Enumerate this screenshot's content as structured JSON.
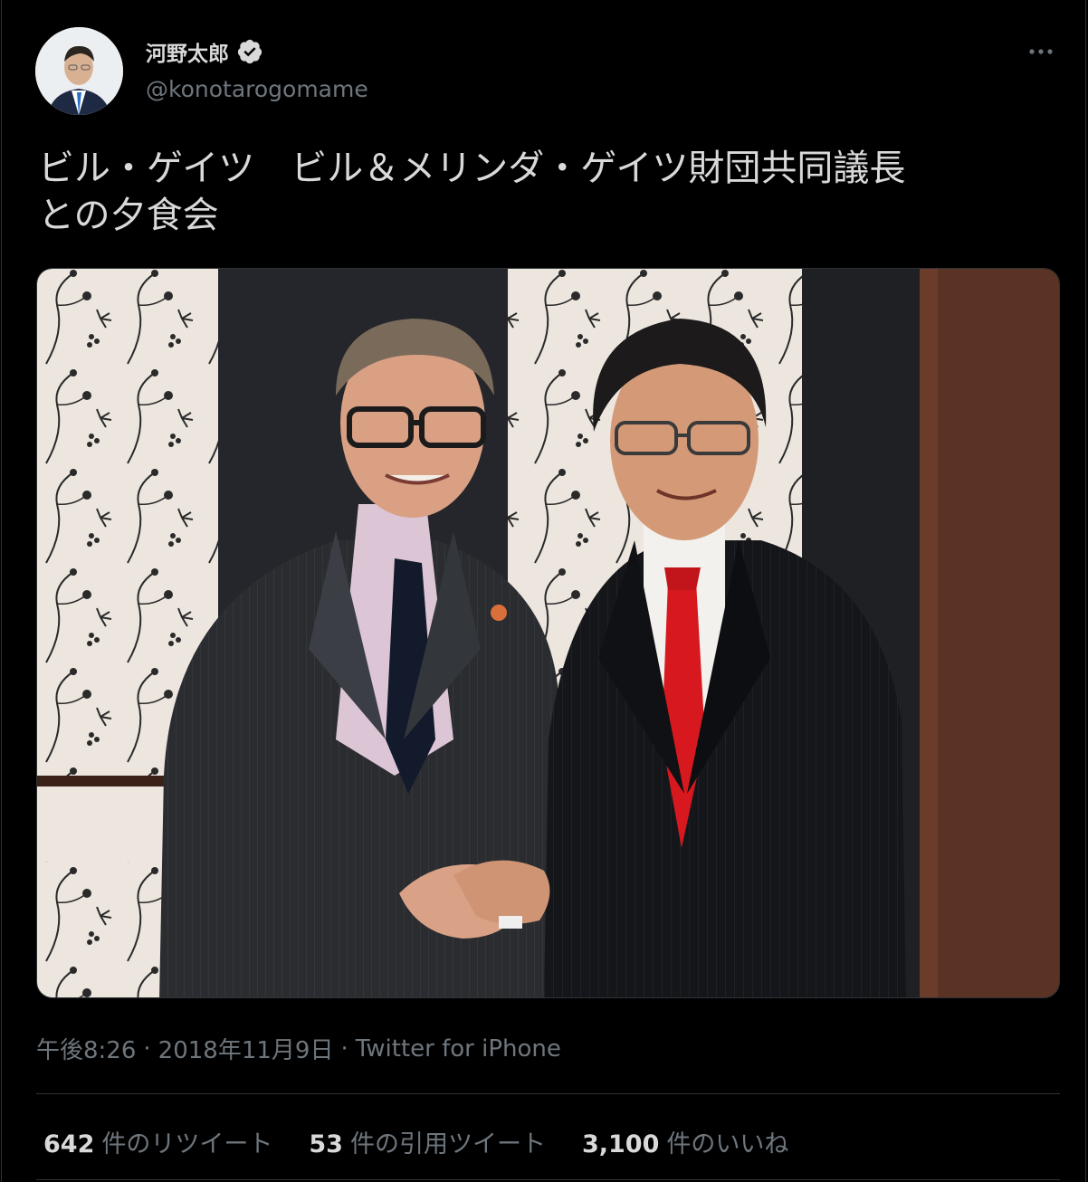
{
  "author": {
    "name": "河野太郎",
    "handle": "@konotarogomame",
    "verified_icon": "verified-badge-icon"
  },
  "more_icon": "more-horizontal-icon",
  "tweet": {
    "text": "ビル・ゲイツ　ビル＆メリンダ・ゲイツ財団共同議長\nとの夕食会"
  },
  "meta": {
    "time": "午後8:26",
    "date": "2018年11月9日",
    "separator": "·",
    "source": "Twitter for iPhone"
  },
  "stats": [
    {
      "count": "642",
      "label": "件のリツイート"
    },
    {
      "count": "53",
      "label": "件の引用ツイート"
    },
    {
      "count": "3,100",
      "label": "件のいいね"
    }
  ],
  "colors": {
    "background": "#000000",
    "text": "#d9d9d9",
    "secondary": "#6e767d",
    "border": "#2f3336",
    "verified": "#d9d9d9"
  }
}
